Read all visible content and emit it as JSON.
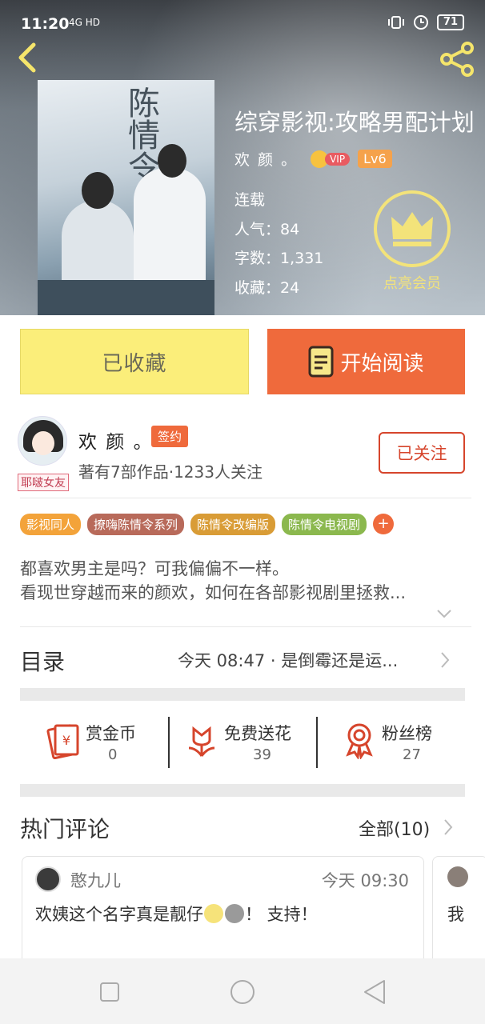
{
  "status_bar": {
    "time": "11:20",
    "signal": "4G HD",
    "battery": "71"
  },
  "book": {
    "title": "综穿影视:攻略男配计划",
    "cover_title": "陈情令",
    "author": "欢 颜 。",
    "vip_label": "VIP",
    "level": "Lv6",
    "status": "连载",
    "popularity": "人气：84",
    "words": "字数：1,331",
    "favorites": "收藏：24",
    "member_label": "点亮会员"
  },
  "buttons": {
    "collected": "已收藏",
    "start_reading": "开始阅读"
  },
  "author_section": {
    "name": "欢 颜 。",
    "sign_badge": "签约",
    "avatar_tag": "耶啵女友",
    "subtitle": "著有7部作品·1233人关注",
    "follow": "已关注"
  },
  "tags": [
    {
      "label": "影视同人",
      "color": "#f3a33a"
    },
    {
      "label": "撩嗨陈情令系列",
      "color": "#b86a5a"
    },
    {
      "label": "陈情令改编版",
      "color": "#d99c36"
    },
    {
      "label": "陈情令电视剧",
      "color": "#8bb84e"
    }
  ],
  "tags_more": "+",
  "description": {
    "line1": "都喜欢男主是吗？可我偏偏不一样。",
    "line2": "看现世穿越而来的颜欢，如何在各部影视剧里拯救..."
  },
  "toc": {
    "label": "目录",
    "latest": "今天 08:47 · 是倒霉还是运..."
  },
  "actions": [
    {
      "title": "赏金币",
      "value": "0"
    },
    {
      "title": "免费送花",
      "value": "39"
    },
    {
      "title": "粉丝榜",
      "value": "27"
    }
  ],
  "comments": {
    "title": "热门评论",
    "all": "全部(10)",
    "items": [
      {
        "user": "憨九儿",
        "time": "今天 09:30",
        "text_before": "欢姨这个名字真是靓仔",
        "text_after": "！ 支持！"
      }
    ],
    "partial_next": "我"
  },
  "colors": {
    "accent": "#ef6a3c",
    "collected_bg": "#fbee7a",
    "member": "#f3e37a"
  }
}
